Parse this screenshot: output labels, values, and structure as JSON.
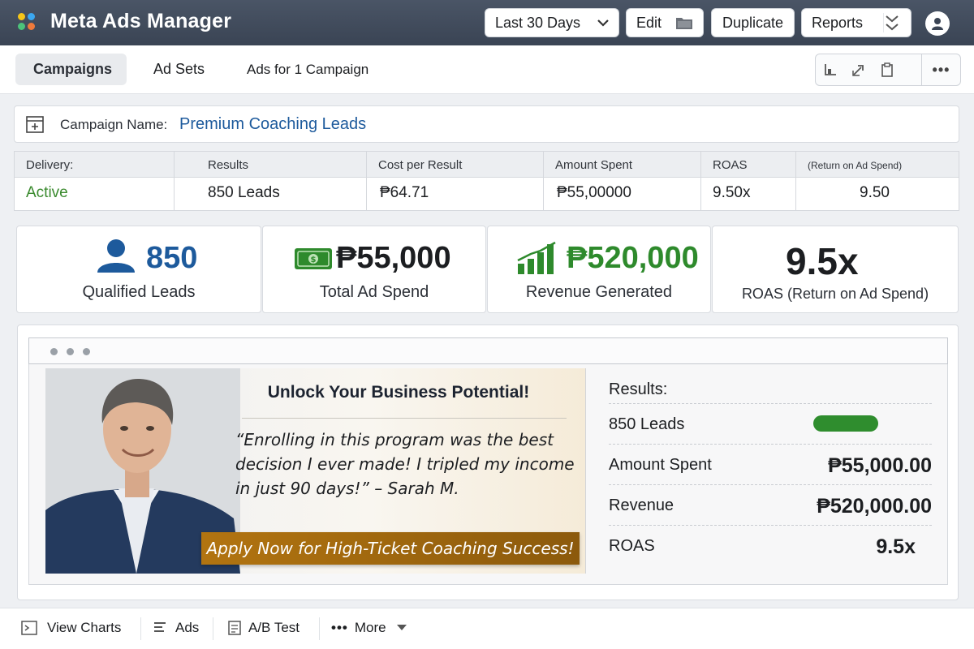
{
  "app": {
    "title": "Meta Ads Manager",
    "logo_colors": [
      "#f5c518",
      "#3ba7f0",
      "#4cc27a",
      "#f07a3b"
    ]
  },
  "toolbar": {
    "date_range": "Last 30 Days",
    "edit_label": "Edit",
    "duplicate_label": "Duplicate",
    "reports_label": "Reports"
  },
  "tabs": [
    {
      "label": "Campaigns",
      "active": true
    },
    {
      "label": "Ad Sets",
      "active": false
    },
    {
      "label": "Ads for 1 Campaign",
      "active": false
    }
  ],
  "view_tools": [
    "chart-icon",
    "share-icon",
    "clipboard-icon",
    "more-icon"
  ],
  "campaign": {
    "name_label": "Campaign Name:",
    "name": "Premium Coaching Leads"
  },
  "summary": {
    "columns": [
      {
        "header": "Delivery:",
        "value": "Active"
      },
      {
        "header": "Results",
        "value": "850 Leads"
      },
      {
        "header": "Cost per Result",
        "value": "₱64.71"
      },
      {
        "header": "Amount Spent",
        "value": "₱55,00000"
      },
      {
        "header": "ROAS",
        "value": "9.50x"
      },
      {
        "header": "(Return on Ad Spend)",
        "value": "9.50"
      }
    ]
  },
  "kpis": [
    {
      "value": "850",
      "label": "Qualified Leads",
      "icon": "user-icon",
      "color": "#1d5a9c"
    },
    {
      "value": "₱55,000",
      "label": "Total Ad Spend",
      "icon": "cash-icon",
      "color": "#1c1e21"
    },
    {
      "value": "₱520,000",
      "label": "Revenue Generated",
      "icon": "growth-chart-icon",
      "color": "#2e8a2c"
    },
    {
      "value": "9.5x",
      "label": "ROAS (Return on Ad Spend)",
      "icon": "",
      "color": "#1c1e21"
    }
  ],
  "ad_preview": {
    "headline": "Unlock Your Business Potential!",
    "quote": "“Enrolling in this program was the best decision I ever made! I tripled my income in just 90 days!” – Sarah M.",
    "cta": "Apply Now for High-Ticket Coaching Success!",
    "results_title": "Results:",
    "results": [
      {
        "label": "850 Leads",
        "value": "",
        "progress": 1.0
      },
      {
        "label": "Amount Spent",
        "value": "₱55,000.00"
      },
      {
        "label": "Revenue",
        "value": "₱520,000.00"
      },
      {
        "label": "ROAS",
        "value": "9.5x"
      }
    ]
  },
  "bottom_actions": [
    {
      "label": "View Charts",
      "icon": "charts-icon"
    },
    {
      "label": "Ads",
      "icon": "ads-icon"
    },
    {
      "label": "A/B Test",
      "icon": "ab-test-icon"
    },
    {
      "label": "More",
      "icon": "more-dots-icon"
    }
  ]
}
